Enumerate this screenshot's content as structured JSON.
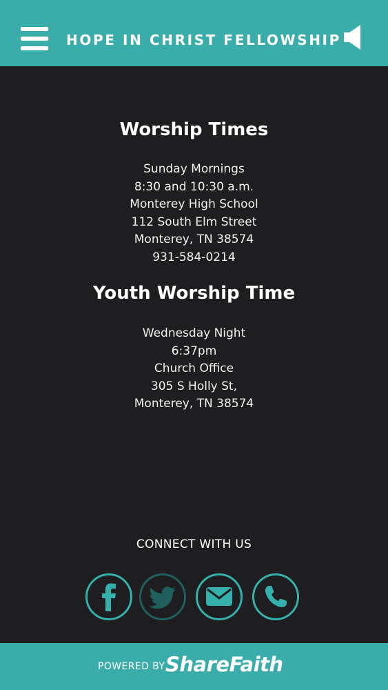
{
  "header": {
    "title": "HOPE IN CHRIST FELLOWSHIP",
    "menu_icon": "hamburger-menu-icon",
    "audio_icon": "speaker-icon"
  },
  "worship": {
    "title": "Worship Times",
    "lines": [
      "Sunday Mornings",
      "8:30 and 10:30 a.m.",
      "Monterey High School",
      "112 South Elm Street",
      "Monterey, TN 38574",
      "931-584-0214"
    ]
  },
  "youth": {
    "title": "Youth Worship Time",
    "lines": [
      "Wednesday Night",
      "6:37pm",
      "Church Office",
      "305 S Holly St,",
      "Monterey, TN 38574"
    ]
  },
  "connect": {
    "label": "CONNECT WITH US",
    "icons": [
      "facebook-icon",
      "twitter-icon",
      "email-icon",
      "phone-icon"
    ]
  },
  "footer": {
    "powered_by": "POWERED BY",
    "brand": "ShareFaith"
  },
  "colors": {
    "accent": "#3aacaa",
    "background": "#1e1e20",
    "icon_ring": "#36b0ab"
  }
}
